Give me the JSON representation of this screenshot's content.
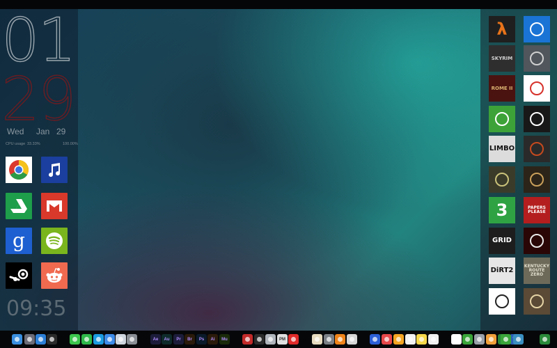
{
  "clock": {
    "hour": "01",
    "minute": "29",
    "weekday": "Wed",
    "month": "Jan",
    "day": "29",
    "cpu_label": "CPU usage",
    "cpu_value": "33.33%",
    "cpu_max": "100.00%",
    "time": "09:35"
  },
  "left_apps": [
    {
      "name": "Chrome",
      "icon": "chrome-icon",
      "color": "#ffffff"
    },
    {
      "name": "iTunes",
      "icon": "music-note-icon",
      "color": "#1a3f9e"
    },
    {
      "name": "Google Drive",
      "icon": "google-drive-icon",
      "color": "#1e9e4a"
    },
    {
      "name": "Gmail",
      "icon": "gmail-icon",
      "color": "#d8392b"
    },
    {
      "name": "Google",
      "icon": "google-g-icon",
      "color": "#1e5fd1"
    },
    {
      "name": "Spotify",
      "icon": "spotify-icon",
      "color": "#7ab51d"
    },
    {
      "name": "Steam",
      "icon": "steam-icon",
      "color": "#000000"
    },
    {
      "name": "Reddit",
      "icon": "reddit-icon",
      "color": "#f06a50"
    }
  ],
  "games": [
    {
      "name": "Half-Life",
      "icon": "half-life-lambda-icon",
      "color": "#1f1f1f",
      "fg": "#e8731a",
      "text": "λ"
    },
    {
      "name": "Portal",
      "icon": "portal-figure-icon",
      "color": "#1a74d6",
      "fg": "#ffffff",
      "text": ""
    },
    {
      "name": "Skyrim",
      "icon": "skyrim-icon",
      "color": "#2e2e2e",
      "fg": "#cfcfcf",
      "text": "SKYRIM"
    },
    {
      "name": "Batman",
      "icon": "batman-icon",
      "color": "#50565c",
      "fg": "#d0d0d0",
      "text": ""
    },
    {
      "name": "Rome II",
      "icon": "rome-ii-icon",
      "color": "#4a1310",
      "fg": "#d9b070",
      "text": "ROME II"
    },
    {
      "name": "Super Meat Boy",
      "icon": "meat-boy-icon",
      "color": "#ffffff",
      "fg": "#d6312a",
      "text": ""
    },
    {
      "name": "Minecraft",
      "icon": "creeper-icon",
      "color": "#3da338",
      "fg": "#ffffff",
      "text": ""
    },
    {
      "name": "Black Mesa",
      "icon": "black-mesa-icon",
      "color": "#181818",
      "fg": "#ffffff",
      "text": ""
    },
    {
      "name": "Limbo",
      "icon": "limbo-icon",
      "color": "#dcdcdc",
      "fg": "#111111",
      "text": "LIMBO"
    },
    {
      "name": "Team Fortress 2",
      "icon": "tf2-icon",
      "color": "#2a2a2a",
      "fg": "#c64a1e",
      "text": ""
    },
    {
      "name": "Fallout",
      "icon": "fallout-icon",
      "color": "#3b3b2a",
      "fg": "#c9c27a",
      "text": ""
    },
    {
      "name": "Fallout New Vegas",
      "icon": "fallout-nv-icon",
      "color": "#2c2418",
      "fg": "#caa05b",
      "text": ""
    },
    {
      "name": "Minecraft Realms",
      "icon": "green-diamond-icon",
      "color": "#2fa343",
      "fg": "#ffffff",
      "text": "3"
    },
    {
      "name": "Papers, Please",
      "icon": "papers-please-icon",
      "color": "#b41e1e",
      "fg": "#ffffff",
      "text": "PAPERS PLEASE"
    },
    {
      "name": "GRID",
      "icon": "grid-icon",
      "color": "#1d1d1d",
      "fg": "#ffffff",
      "text": "GRID"
    },
    {
      "name": "Hitman",
      "icon": "hitman-icon",
      "color": "#2a0606",
      "fg": "#e8e8e8",
      "text": ""
    },
    {
      "name": "DiRT 2",
      "icon": "dirt2-icon",
      "color": "#e6e6e6",
      "fg": "#111111",
      "text": "DiRT2"
    },
    {
      "name": "Kentucky Route Zero",
      "icon": "kentucky-route-zero-icon",
      "color": "#6e6a5a",
      "fg": "#e0ddcc",
      "text": "KENTUCKY ROUTE ZERO"
    },
    {
      "name": "Counter-Strike",
      "icon": "counter-strike-icon",
      "color": "#ffffff",
      "fg": "#222222",
      "text": ""
    },
    {
      "name": "Fallout 2",
      "icon": "fallout2-icon",
      "color": "#5a4a36",
      "fg": "#e6d4a6",
      "text": ""
    }
  ],
  "dock": [
    {
      "name": "Finder",
      "icon": "finder-icon",
      "color": "#3a8fe0",
      "text": ""
    },
    {
      "name": "Launchpad",
      "icon": "launchpad-icon",
      "color": "#6c6c78",
      "text": ""
    },
    {
      "name": "Safari",
      "icon": "safari-icon",
      "color": "#2d7fd6",
      "text": ""
    },
    {
      "name": "Terminal",
      "icon": "terminal-icon",
      "color": "#2b2b2b",
      "text": ""
    },
    {
      "name": "Messages",
      "icon": "messages-icon",
      "color": "#3cc64d",
      "text": ""
    },
    {
      "name": "FaceTime",
      "icon": "facetime-icon",
      "color": "#2fb84a",
      "text": ""
    },
    {
      "name": "Skype",
      "icon": "skype-icon",
      "color": "#1b9be0",
      "text": ""
    },
    {
      "name": "Mail",
      "icon": "mail-icon",
      "color": "#3d8be8",
      "text": ""
    },
    {
      "name": "Photos",
      "icon": "photos-icon",
      "color": "#cfd6de",
      "text": ""
    },
    {
      "name": "Preview",
      "icon": "preview-icon",
      "color": "#8a8f96",
      "text": ""
    },
    {
      "name": "After Effects",
      "icon": "after-effects-icon",
      "color": "#1c1c3a",
      "text": "Ae"
    },
    {
      "name": "Audition",
      "icon": "audition-icon",
      "color": "#0f2a2a",
      "text": "Au"
    },
    {
      "name": "Premiere",
      "icon": "premiere-icon",
      "color": "#1c1c3a",
      "text": "Pr"
    },
    {
      "name": "Bridge",
      "icon": "bridge-icon",
      "color": "#2a1a0a",
      "text": "Br"
    },
    {
      "name": "Photoshop",
      "icon": "photoshop-icon",
      "color": "#0a1a2a",
      "text": "Ps"
    },
    {
      "name": "Illustrator",
      "icon": "illustrator-icon",
      "color": "#2a1a0a",
      "text": "Ai"
    },
    {
      "name": "Muse",
      "icon": "muse-icon",
      "color": "#1a2a0a",
      "text": "Mu"
    },
    {
      "name": "App Store Red",
      "icon": "red-app-icon",
      "color": "#c22a2a",
      "text": ""
    },
    {
      "name": "Final Cut",
      "icon": "clapper-icon",
      "color": "#2b2b2b",
      "text": ""
    },
    {
      "name": "Photo Editor",
      "icon": "photo-editor-icon",
      "color": "#b0b5bc",
      "text": ""
    },
    {
      "name": "Pixelmator",
      "icon": "pixelmator-icon",
      "color": "#e0e0e0",
      "text": "PM"
    },
    {
      "name": "YouTube",
      "icon": "youtube-icon",
      "color": "#e02a2a",
      "text": ""
    },
    {
      "name": "Gears",
      "icon": "gears-icon",
      "color": "#e8dcc0",
      "text": ""
    },
    {
      "name": "System Preferences",
      "icon": "system-prefs-icon",
      "color": "#7a7f86",
      "text": ""
    },
    {
      "name": "VLC",
      "icon": "vlc-icon",
      "color": "#f0841a",
      "text": ""
    },
    {
      "name": "Disk Utility",
      "icon": "disk-utility-icon",
      "color": "#d6d6d6",
      "text": ""
    },
    {
      "name": "iTunes Dock",
      "icon": "itunes-icon",
      "color": "#2b5fd6",
      "text": ""
    },
    {
      "name": "App Red",
      "icon": "app-red-icon",
      "color": "#e8484a",
      "text": ""
    },
    {
      "name": "Sketch",
      "icon": "sketch-icon",
      "color": "#f5a623",
      "text": ""
    },
    {
      "name": "TextEdit",
      "icon": "textedit-icon",
      "color": "#f2f2f2",
      "text": ""
    },
    {
      "name": "Notes",
      "icon": "notes-icon",
      "color": "#f7d84a",
      "text": ""
    },
    {
      "name": "Reminders",
      "icon": "reminders-icon",
      "color": "#f0f0f0",
      "text": ""
    },
    {
      "name": "Calendar",
      "icon": "calendar-icon",
      "color": "#ffffff",
      "text": ""
    },
    {
      "name": "Cydia",
      "icon": "green-leaf-icon",
      "color": "#3aa63a",
      "text": ""
    },
    {
      "name": "Tools",
      "icon": "tools-icon",
      "color": "#9aa0a8",
      "text": ""
    },
    {
      "name": "Amazon",
      "icon": "amazon-icon",
      "color": "#f0a03a",
      "text": ""
    },
    {
      "name": "Stats",
      "icon": "stats-icon",
      "color": "#2a8a3a",
      "text": ""
    },
    {
      "name": "Word",
      "icon": "word-icon",
      "color": "#2b5fb8",
      "text": "W"
    },
    {
      "name": "Excel",
      "icon": "excel-icon",
      "color": "#2a8a3a",
      "text": ""
    },
    {
      "name": "Numbers",
      "icon": "numbers-icon",
      "color": "#3aa63a",
      "text": ""
    },
    {
      "name": "Trash",
      "icon": "trash-icon",
      "color": "#3a8fc0",
      "text": ""
    }
  ]
}
